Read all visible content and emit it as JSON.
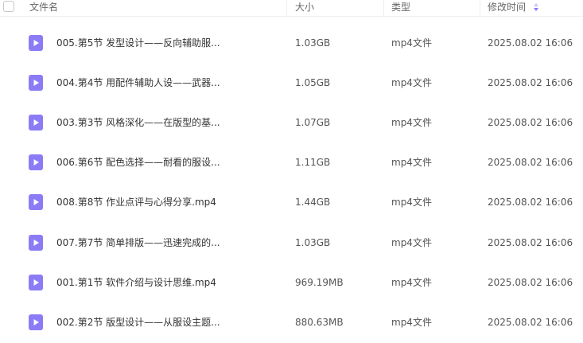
{
  "columns": {
    "name": "文件名",
    "size": "大小",
    "type": "类型",
    "modified": "修改时间"
  },
  "accent_color": "#8b7cf6",
  "sort_icon": "sort-icon",
  "file_icon": "video-file-icon",
  "files": [
    {
      "name": "005.第5节 发型设计——反向辅助服...",
      "size": "1.03GB",
      "type": "mp4文件",
      "modified": "2025.08.02 16:06"
    },
    {
      "name": "004.第4节 用配件辅助人设——武器...",
      "size": "1.05GB",
      "type": "mp4文件",
      "modified": "2025.08.02 16:06"
    },
    {
      "name": "003.第3节 风格深化——在版型的基...",
      "size": "1.07GB",
      "type": "mp4文件",
      "modified": "2025.08.02 16:06"
    },
    {
      "name": "006.第6节 配色选择——耐看的服设...",
      "size": "1.11GB",
      "type": "mp4文件",
      "modified": "2025.08.02 16:06"
    },
    {
      "name": "008.第8节 作业点评与心得分享.mp4",
      "size": "1.44GB",
      "type": "mp4文件",
      "modified": "2025.08.02 16:06"
    },
    {
      "name": "007.第7节 简单排版——迅速完成的...",
      "size": "1.03GB",
      "type": "mp4文件",
      "modified": "2025.08.02 16:06"
    },
    {
      "name": "001.第1节 软件介绍与设计思维.mp4",
      "size": "969.19MB",
      "type": "mp4文件",
      "modified": "2025.08.02 16:06"
    },
    {
      "name": "002.第2节 版型设计——从服设主题...",
      "size": "880.63MB",
      "type": "mp4文件",
      "modified": "2025.08.02 16:06"
    }
  ]
}
